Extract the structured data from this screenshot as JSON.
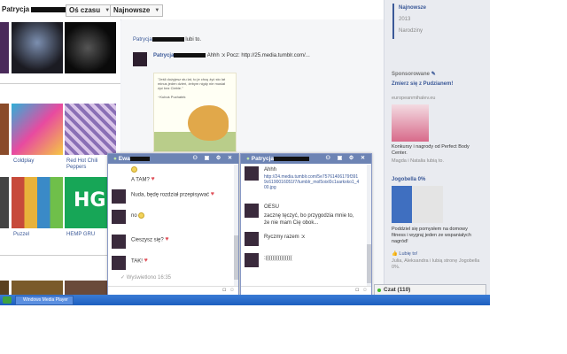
{
  "topbar": {
    "name": "Patrycja",
    "dropdown1": "Oś czasu",
    "dropdown2": "Najnowsze"
  },
  "left_tiles": [
    {
      "label": "Coldplay"
    },
    {
      "label": "Red Hot Chili Peppers"
    },
    {
      "label": "Puzzel"
    },
    {
      "label": "HEMP GRU"
    }
  ],
  "feed": {
    "line1": "Patrycja",
    "line1_suffix": "lubi to.",
    "post_author": "Patrycja",
    "post_text": "Ahhh :x Pocz: http://25.media.tumblr.com/...",
    "quote": "\"Jeśli dożyjesz stu lat, to je chcę żyć sto lat minus jeden dzień, żebym nigdy nie musiał żyć bez Ciebie.\"",
    "quote_author": "~Kubuś Puchatek"
  },
  "timeline": {
    "item1": "Najnowsze",
    "item2": "2013",
    "item3": "Narodziny"
  },
  "sponsored": {
    "title": "Sponsorowane",
    "ad1_title": "Zmierz się z Pudzianem!",
    "ad1_url": "europeanmihalev.eu",
    "ad1_text": "Konkursy i nagrody od Perfect Body Center.",
    "ad1_social": "Magda i Natalia lubią to.",
    "ad2_title": "Jogobella 0%",
    "ad2_text": "Poddziel się pomysłem na domowy fitness i wygraj jeden ze wspaniałych nagród!",
    "ad2_like": "Lubię to!",
    "ad2_social": "Julia, Aleksandra i lubią stronę Jogobella 0%."
  },
  "chat1": {
    "title": "Ewa",
    "messages": [
      {
        "text": "A TAM?"
      },
      {
        "text": "Nuda, będę rozdział przepisywać"
      },
      {
        "text": "no"
      },
      {
        "text": "Cieszysz się?"
      },
      {
        "text": "TAK!"
      }
    ],
    "seen": "Wyświetlono 16:35"
  },
  "chat2": {
    "title": "Patrycja",
    "messages": [
      {
        "text": "Ahhh"
      },
      {
        "text": "http://24.media.tumblr.com/5e75761406179f3919c6190016051f7/tumblr_mol5oixl0c1sarkxko1_400.jpg"
      },
      {
        "text": "OESU"
      },
      {
        "text": "zacznę tęczyć, bo przygodzia mnie to, że nie mam Cię obok..."
      },
      {
        "text": "Ryczmy razem :x"
      },
      {
        "text": ":((((((((((((((("
      }
    ]
  },
  "chat_bar": {
    "label": "Czat (110)"
  },
  "taskbar": {
    "item": "Windows Media Player"
  }
}
